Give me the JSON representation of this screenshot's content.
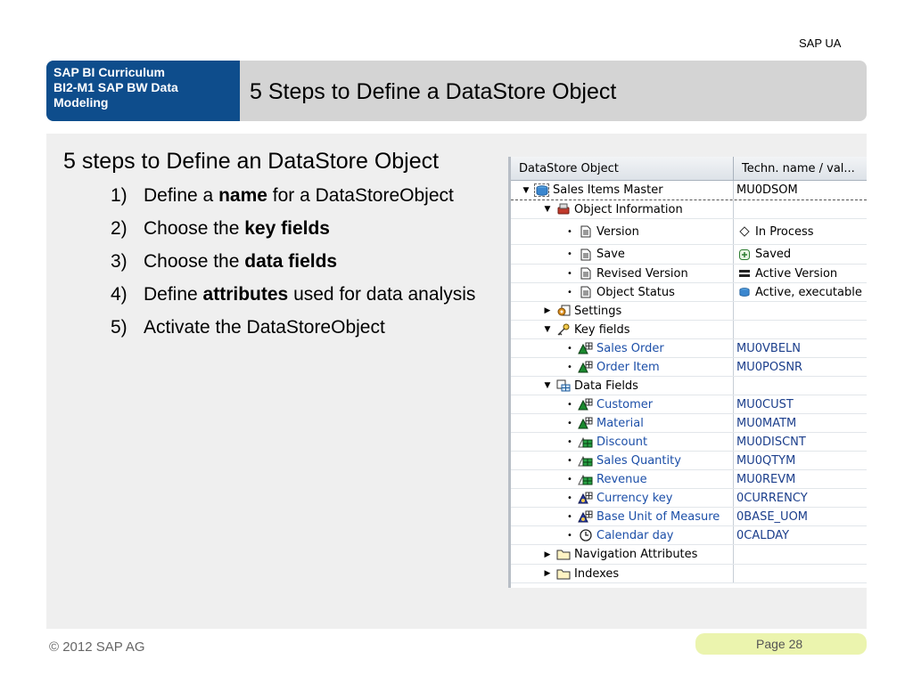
{
  "top_label": "SAP UA",
  "header": {
    "curriculum_lines": [
      "SAP BI Curriculum",
      "BI2-M1 SAP BW Data",
      "Modeling"
    ],
    "title": "5 Steps to Define a DataStore Object"
  },
  "content": {
    "heading": "5 steps to Define an DataStore Object",
    "steps": [
      {
        "num": "1)",
        "pre": "Define a ",
        "bold": "name",
        "post": " for a DataStoreObject"
      },
      {
        "num": "2)",
        "pre": "Choose the ",
        "bold": "key fields",
        "post": ""
      },
      {
        "num": "3)",
        "pre": "Choose the ",
        "bold": "data fields",
        "post": ""
      },
      {
        "num": "4)",
        "pre": "Define ",
        "bold": "attributes",
        "post": " used for data analysis"
      },
      {
        "num": "5)",
        "pre": "Activate the DataStoreObject",
        "bold": "",
        "post": ""
      }
    ]
  },
  "tree": {
    "columns": [
      "DataStore Object",
      "Techn. name / val..."
    ],
    "rows": {
      "sales_items_master": {
        "label": "Sales Items Master",
        "value": "MU0DSOM"
      },
      "object_information": {
        "label": "Object Information",
        "value": ""
      },
      "version": {
        "label": "Version",
        "value": "In Process"
      },
      "save": {
        "label": "Save",
        "value": "Saved"
      },
      "revised_version": {
        "label": "Revised Version",
        "value": "Active Version"
      },
      "object_status": {
        "label": "Object Status",
        "value": "Active, executable"
      },
      "settings": {
        "label": "Settings",
        "value": ""
      },
      "key_fields": {
        "label": "Key fields",
        "value": ""
      },
      "sales_order": {
        "label": "Sales Order",
        "value": "MU0VBELN"
      },
      "order_item": {
        "label": "Order Item",
        "value": "MU0POSNR"
      },
      "data_fields": {
        "label": "Data Fields",
        "value": ""
      },
      "customer": {
        "label": "Customer",
        "value": "MU0CUST"
      },
      "material": {
        "label": "Material",
        "value": "MU0MATM"
      },
      "discount": {
        "label": "Discount",
        "value": "MU0DISCNT"
      },
      "sales_quantity": {
        "label": "Sales Quantity",
        "value": "MU0QTYM"
      },
      "revenue": {
        "label": "Revenue",
        "value": "MU0REVM"
      },
      "currency_key": {
        "label": "Currency key",
        "value": "0CURRENCY"
      },
      "base_unit": {
        "label": "Base Unit of Measure",
        "value": "0BASE_UOM"
      },
      "calendar_day": {
        "label": "Calendar day",
        "value": "0CALDAY"
      },
      "navigation_attributes": {
        "label": "Navigation Attributes",
        "value": ""
      },
      "indexes": {
        "label": "Indexes",
        "value": ""
      }
    }
  },
  "footer": {
    "copyright": "© 2012 SAP AG",
    "page": "Page 28"
  },
  "colors": {
    "header_blue": "#0e4d8c",
    "header_gray": "#d4d4d4",
    "page_pill": "#ebf4ae",
    "link_blue": "#1c4fa8"
  }
}
